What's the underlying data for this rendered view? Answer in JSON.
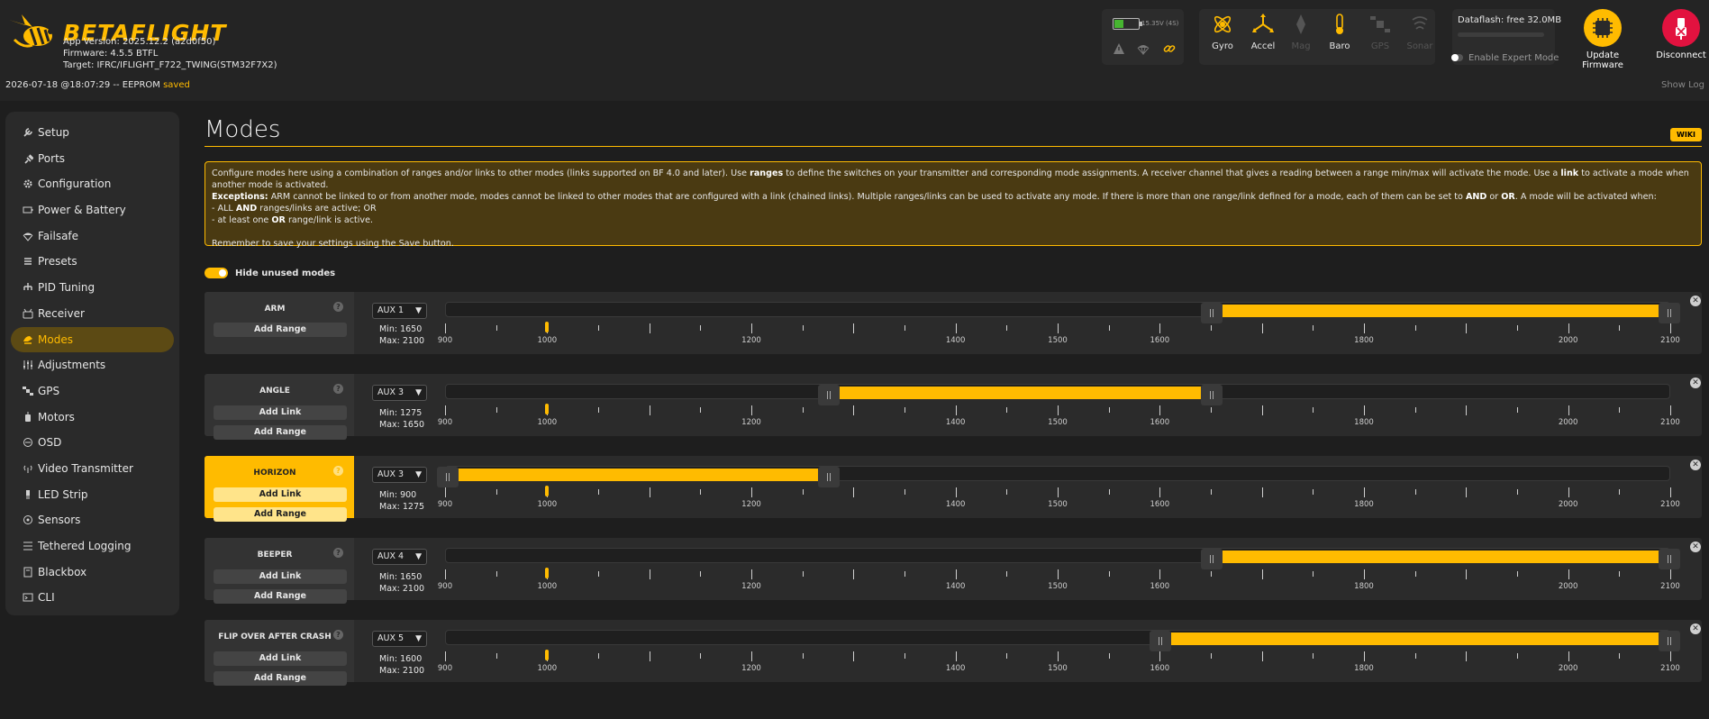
{
  "header": {
    "brand": "BETAFLIGHT",
    "app_version": "App Version: 2025.12.2 (a2d0f50)",
    "firmware": "Firmware: 4.5.5 BTFL",
    "target": "Target: IFRC/IFLIGHT_F722_TWING(STM32F7X2)",
    "rtc_prefix": "2026-07-18 @18:07:29 -- EEPROM ",
    "rtc_saved": "saved",
    "battery": "15.35V (4S)",
    "battery_fraction": 0.4,
    "sensors": [
      {
        "name": "Gyro",
        "on": true
      },
      {
        "name": "Accel",
        "on": true
      },
      {
        "name": "Mag",
        "on": false
      },
      {
        "name": "Baro",
        "on": true
      },
      {
        "name": "GPS",
        "on": false
      },
      {
        "name": "Sonar",
        "on": false
      }
    ],
    "dataflash": "Dataflash: free 32.0MB",
    "expert_mode": "Enable Expert Mode",
    "update_firmware": "Update Firmware",
    "disconnect": "Disconnect",
    "show_log": "Show Log",
    "accent": "#ffbb00",
    "disconnect_color": "#e2123f"
  },
  "nav": [
    {
      "label": "Setup",
      "icon": "wrench-icon"
    },
    {
      "label": "Ports",
      "icon": "plug-icon"
    },
    {
      "label": "Configuration",
      "icon": "gear-icon"
    },
    {
      "label": "Power & Battery",
      "icon": "battery-icon"
    },
    {
      "label": "Failsafe",
      "icon": "parachute-icon"
    },
    {
      "label": "Presets",
      "icon": "presets-icon"
    },
    {
      "label": "PID Tuning",
      "icon": "pid-icon"
    },
    {
      "label": "Receiver",
      "icon": "receiver-icon"
    },
    {
      "label": "Modes",
      "icon": "modes-icon",
      "active": true
    },
    {
      "label": "Adjustments",
      "icon": "sliders-icon"
    },
    {
      "label": "GPS",
      "icon": "satellite-icon"
    },
    {
      "label": "Motors",
      "icon": "motor-icon"
    },
    {
      "label": "OSD",
      "icon": "osd-icon"
    },
    {
      "label": "Video Transmitter",
      "icon": "antenna-icon"
    },
    {
      "label": "LED Strip",
      "icon": "led-icon"
    },
    {
      "label": "Sensors",
      "icon": "sensor-icon"
    },
    {
      "label": "Tethered Logging",
      "icon": "logging-icon"
    },
    {
      "label": "Blackbox",
      "icon": "blackbox-icon"
    },
    {
      "label": "CLI",
      "icon": "terminal-icon"
    }
  ],
  "page": {
    "title": "Modes",
    "wiki": "WIKI",
    "note_line1_a": "Configure modes here using a combination of ranges and/or links to other modes (links supported on BF 4.0 and later). Use ",
    "note_line1_b": "ranges",
    "note_line1_c": " to define the switches on your transmitter and corresponding mode assignments. A receiver channel that gives a reading between a range min/max will activate the mode. Use a ",
    "note_line1_d": "link",
    "note_line1_e": " to activate a mode when another mode is activated.",
    "note_line2_a": "Exceptions:",
    "note_line2_b": " ARM cannot be linked to or from another mode, modes cannot be linked to other modes that are configured with a link (chained links). Multiple ranges/links can be used to activate any mode. If there is more than one range/link defined for a mode, each of them can be set to ",
    "note_line2_c": "AND",
    "note_line2_d": " or ",
    "note_line2_e": "OR",
    "note_line2_f": ". A mode will be activated when:",
    "note_line3_a": "- ALL ",
    "note_line3_b": "AND",
    "note_line3_c": " ranges/links are active; OR",
    "note_line4_a": "- at least one ",
    "note_line4_b": "OR",
    "note_line4_c": " range/link is active.",
    "note_line5": "Remember to save your settings using the Save button.",
    "hide_unused": "Hide unused modes"
  },
  "scale": {
    "min": 900,
    "max": 2100,
    "labels": [
      900,
      1000,
      1200,
      1400,
      1500,
      1600,
      1800,
      2000,
      2100
    ]
  },
  "modes": [
    {
      "name": "ARM",
      "buttons": [
        "Add Range"
      ],
      "channel": "AUX 1",
      "min_label": "Min: 1650",
      "max_label": "Max: 2100",
      "min": 1650,
      "max": 2100,
      "marker": 1000,
      "active": false
    },
    {
      "name": "ANGLE",
      "buttons": [
        "Add Link",
        "Add Range"
      ],
      "channel": "AUX 3",
      "min_label": "Min: 1275",
      "max_label": "Max: 1650",
      "min": 1275,
      "max": 1650,
      "marker": 1000,
      "active": false
    },
    {
      "name": "HORIZON",
      "buttons": [
        "Add Link",
        "Add Range"
      ],
      "channel": "AUX 3",
      "min_label": "Min: 900",
      "max_label": "Max: 1275",
      "min": 900,
      "max": 1275,
      "marker": 1000,
      "active": true
    },
    {
      "name": "BEEPER",
      "buttons": [
        "Add Link",
        "Add Range"
      ],
      "channel": "AUX 4",
      "min_label": "Min: 1650",
      "max_label": "Max: 2100",
      "min": 1650,
      "max": 2100,
      "marker": 1000,
      "active": false
    },
    {
      "name": "FLIP OVER AFTER CRASH",
      "buttons": [
        "Add Link",
        "Add Range"
      ],
      "channel": "AUX 5",
      "min_label": "Min: 1600",
      "max_label": "Max: 2100",
      "min": 1600,
      "max": 2100,
      "marker": 1000,
      "active": false
    }
  ]
}
